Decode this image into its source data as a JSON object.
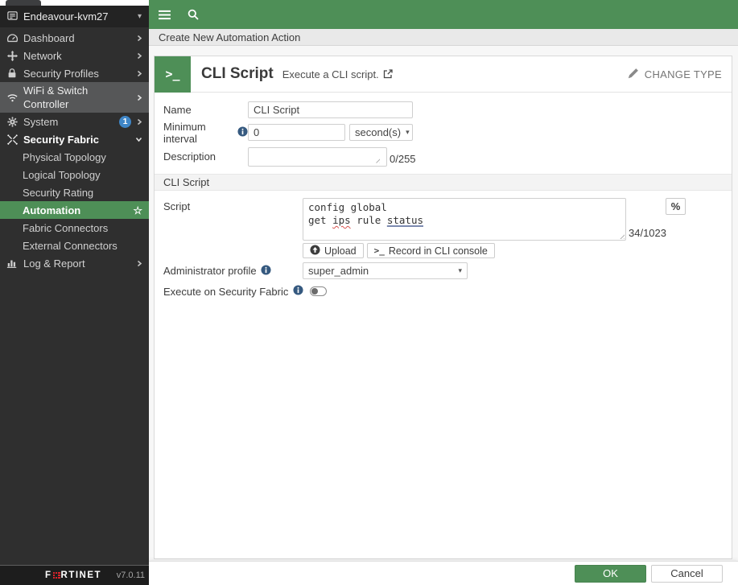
{
  "colors": {
    "accent_green": "#4e8f57",
    "sidebar_bg": "#2f2f2f",
    "info_blue": "#35597f",
    "badge_blue": "#3f86c7",
    "logo_red": "#d9232a"
  },
  "icons": {
    "terminal_glyph": ">_",
    "star_glyph": "☆",
    "caret_glyph": "▾",
    "percent_glyph": "%"
  },
  "sidebar": {
    "hostname": "Endeavour-kvm27",
    "items": [
      {
        "label": "Dashboard"
      },
      {
        "label": "Network"
      },
      {
        "label": "Security Profiles"
      },
      {
        "label": "WiFi & Switch Controller"
      },
      {
        "label": "System",
        "badge": "1"
      },
      {
        "label": "Security Fabric"
      },
      {
        "label": "Log & Report"
      }
    ],
    "fabric_children": [
      {
        "label": "Physical Topology"
      },
      {
        "label": "Logical Topology"
      },
      {
        "label": "Security Rating"
      },
      {
        "label": "Automation"
      },
      {
        "label": "Fabric Connectors"
      },
      {
        "label": "External Connectors"
      }
    ],
    "footer": {
      "brand_full": "FORTINET",
      "brand_left": "F",
      "brand_right": "RTINET",
      "version": "v7.0.11"
    }
  },
  "header": {
    "breadcrumb": "Create New Automation Action"
  },
  "action_card": {
    "title": "CLI Script",
    "subtitle": "Execute a CLI script.",
    "change_type_label": "CHANGE TYPE"
  },
  "form": {
    "name": {
      "label": "Name",
      "value": "CLI Script"
    },
    "minimum_interval": {
      "label": "Minimum interval",
      "value": "0",
      "unit": "second(s)"
    },
    "description": {
      "label": "Description",
      "value": "",
      "counter": "0/255"
    },
    "section_title": "CLI Script",
    "script": {
      "label": "Script",
      "line1": "config global",
      "line2_parts": {
        "pre": "get ",
        "word1": "ips",
        "mid": " rule ",
        "word2": "status"
      },
      "counter": "34/1023",
      "upload_label": "Upload",
      "record_label": "Record in CLI console"
    },
    "admin_profile": {
      "label": "Administrator profile",
      "value": "super_admin"
    },
    "execute_fabric": {
      "label": "Execute on Security Fabric"
    }
  },
  "footer_buttons": {
    "ok": "OK",
    "cancel": "Cancel"
  }
}
